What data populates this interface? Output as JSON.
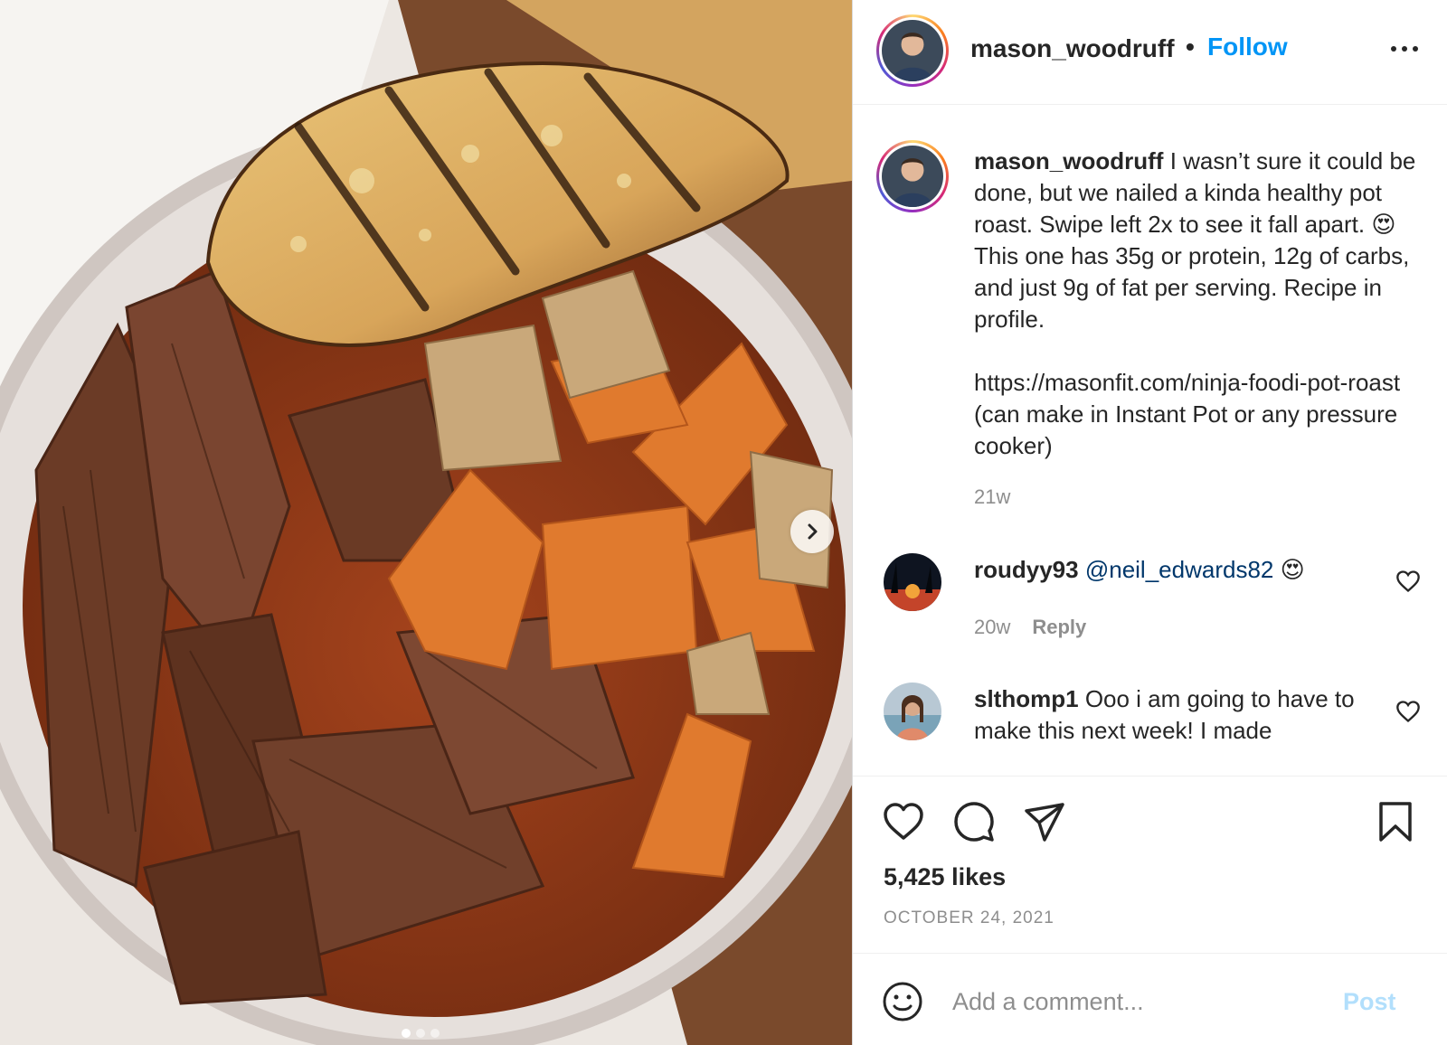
{
  "post": {
    "username": "mason_woodruff",
    "separator": "•",
    "follow_label": "Follow",
    "more_icon": "more-horizontal-icon",
    "next_icon": "chevron-right-icon",
    "carousel": {
      "count": 3,
      "active": 1
    }
  },
  "caption": {
    "username": "mason_woodruff",
    "line1": "I wasn’t sure it could be done, but we nailed a kinda healthy pot roast. Swipe left 2x to see it fall apart.",
    "emoji": "😍",
    "line2": "This one has 35g or protein, 12g of carbs, and just 9g of fat per serving. Recipe in profile.",
    "link_text": "https://masonfit.com/ninja-foodi-pot-roast (can make in Instant Pot or any pressure cooker)",
    "time": "21w"
  },
  "comments": [
    {
      "username": "roudyy93",
      "mention": "@neil_edwards82",
      "emoji": "😍",
      "time": "20w",
      "reply_label": "Reply"
    },
    {
      "username": "slthomp1",
      "text": "Ooo i am going to have to make this next week! I made"
    }
  ],
  "actions": {
    "likes": "5,425 likes",
    "date": "OCTOBER 24, 2021"
  },
  "composer": {
    "placeholder": "Add a comment...",
    "post_label": "Post"
  },
  "colors": {
    "link": "#0095f6",
    "mention": "#00376b",
    "muted": "#8e8e8e",
    "post_disabled": "#b2dffc"
  }
}
